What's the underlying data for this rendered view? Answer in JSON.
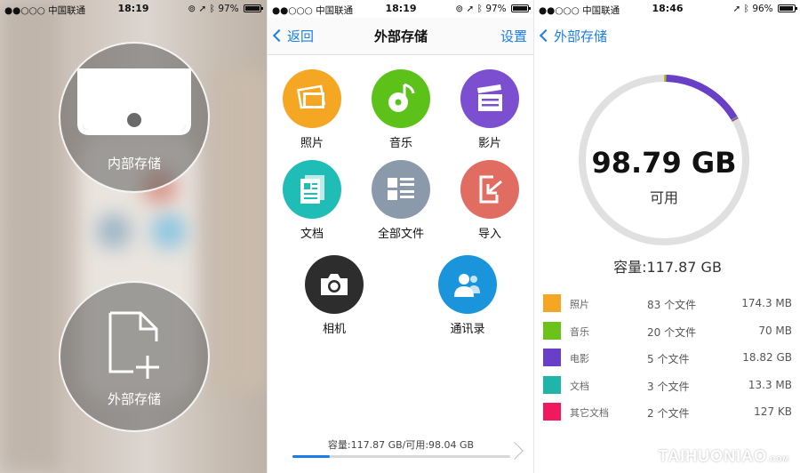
{
  "status_p1": {
    "carrier": "●●○○○ 中国联通",
    "time": "18:19",
    "battery": "97%",
    "battery_level": 0.97
  },
  "status_p2": {
    "carrier": "●●○○○ 中国联通",
    "time": "18:19",
    "battery": "97%",
    "battery_level": 0.97
  },
  "status_p3": {
    "carrier": "●●○○○ 中国联通",
    "time": "18:46",
    "battery": "96%",
    "battery_level": 0.96
  },
  "home": {
    "internal_label": "内部存储",
    "external_label": "外部存储"
  },
  "storage": {
    "nav": {
      "back": "返回",
      "title": "外部存储",
      "settings": "设置"
    },
    "tiles": {
      "photos": {
        "label": "照片",
        "color": "#f5a623"
      },
      "music": {
        "label": "音乐",
        "color": "#5cc21a"
      },
      "movies": {
        "label": "影片",
        "color": "#7b4fd0"
      },
      "docs": {
        "label": "文档",
        "color": "#1fbdb5"
      },
      "all_files": {
        "label": "全部文件",
        "color": "#8b9aab"
      },
      "import": {
        "label": "导入",
        "color": "#e06c62"
      },
      "camera": {
        "label": "相机",
        "color": "#2d2d2d"
      },
      "contacts": {
        "label": "通讯录",
        "color": "#1a95dc"
      }
    },
    "capacity_text": "容量:117.87 GB/可用:98.04 GB",
    "capacity_used_fraction": 0.17
  },
  "detail": {
    "nav_back": "外部存储",
    "available_value": "98.79 GB",
    "available_label": "可用",
    "capacity_label": "容量:117.87 GB",
    "ring_track_color": "#e0e0e0",
    "categories": [
      {
        "name": "照片",
        "count": "83 个文件",
        "size": "174.3 MB",
        "color": "#f5a623",
        "gb": 0.1743
      },
      {
        "name": "音乐",
        "count": "20 个文件",
        "size": "70 MB",
        "color": "#6bc21a",
        "gb": 0.07
      },
      {
        "name": "电影",
        "count": "5 个文件",
        "size": "18.82 GB",
        "color": "#6a3fc7",
        "gb": 18.82
      },
      {
        "name": "文档",
        "count": "3 个文件",
        "size": "13.3 MB",
        "color": "#1fb5a8",
        "gb": 0.0133
      },
      {
        "name": "其它文档",
        "count": "2 个文件",
        "size": "127 KB",
        "color": "#f0185f",
        "gb": 0.000127
      }
    ],
    "total_gb": 117.87
  },
  "watermark": {
    "text": "TAIHUONIAO",
    "suffix": ".COM"
  }
}
